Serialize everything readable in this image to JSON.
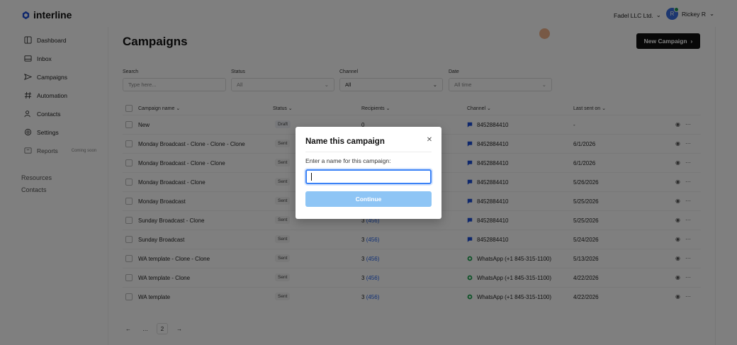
{
  "app": {
    "logo_text": "interline",
    "org_name": "Fadel LLC Ltd.",
    "user_initial": "R",
    "user_name": "Rickey R"
  },
  "sidebar": {
    "items": [
      {
        "label": "Dashboard",
        "icon": "grid-icon"
      },
      {
        "label": "Inbox",
        "icon": "inbox-icon"
      },
      {
        "label": "Campaigns",
        "icon": "send-icon"
      },
      {
        "label": "Automation",
        "icon": "hash-icon"
      },
      {
        "label": "Contacts",
        "icon": "users-icon"
      },
      {
        "label": "Settings",
        "icon": "gear-icon"
      },
      {
        "label": "Reports",
        "icon": "chart-icon",
        "tag": "Coming soon"
      }
    ],
    "resources_label": "Resources",
    "contacts_label": "Contacts"
  },
  "main": {
    "title": "Campaigns",
    "new_button_label": "New Campaign",
    "filters": {
      "search_label": "Search",
      "search_placeholder": "Type here...",
      "status_label": "Status",
      "status_value": "All",
      "channel_label": "Channel",
      "channel_value": "All",
      "date_label": "Date",
      "date_value": "All time"
    },
    "table": {
      "headers": {
        "name": "Campaign name",
        "status": "Status",
        "recipients": "Recipients",
        "channel": "Channel",
        "last_sent": "Last sent on"
      },
      "rows": [
        {
          "name": "New",
          "status": "Draft",
          "recipients": "0",
          "recipients_extra": "",
          "channel": "8452884410",
          "channel_type": "sms",
          "last_sent": "-"
        },
        {
          "name": "Monday Broadcast - Clone - Clone - Clone",
          "status": "Sent",
          "recipients": "",
          "recipients_extra": "",
          "channel": "8452884410",
          "channel_type": "sms",
          "last_sent": "6/1/2026"
        },
        {
          "name": "Monday Broadcast - Clone - Clone",
          "status": "Sent",
          "recipients": "",
          "recipients_extra": "",
          "channel": "8452884410",
          "channel_type": "sms",
          "last_sent": "6/1/2026"
        },
        {
          "name": "Monday Broadcast - Clone",
          "status": "Sent",
          "recipients": "",
          "recipients_extra": "",
          "channel": "8452884410",
          "channel_type": "sms",
          "last_sent": "5/26/2026"
        },
        {
          "name": "Monday Broadcast",
          "status": "Sent",
          "recipients": "",
          "recipients_extra": "",
          "channel": "8452884410",
          "channel_type": "sms",
          "last_sent": "5/25/2026"
        },
        {
          "name": "Sunday Broadcast - Clone",
          "status": "Sent",
          "recipients": "3",
          "recipients_extra": "(456)",
          "channel": "8452884410",
          "channel_type": "sms",
          "last_sent": "5/25/2026"
        },
        {
          "name": "Sunday Broadcast",
          "status": "Sent",
          "recipients": "3",
          "recipients_extra": "(456)",
          "channel": "8452884410",
          "channel_type": "sms",
          "last_sent": "5/24/2026"
        },
        {
          "name": "WA template - Clone - Clone",
          "status": "Sent",
          "recipients": "3",
          "recipients_extra": "(456)",
          "channel": "WhatsApp (+1 845-315-1100)",
          "channel_type": "whatsapp",
          "last_sent": "5/13/2026"
        },
        {
          "name": "WA template - Clone",
          "status": "Sent",
          "recipients": "3",
          "recipients_extra": "(456)",
          "channel": "WhatsApp (+1 845-315-1100)",
          "channel_type": "whatsapp",
          "last_sent": "4/22/2026"
        },
        {
          "name": "WA template",
          "status": "Sent",
          "recipients": "3",
          "recipients_extra": "(456)",
          "channel": "WhatsApp (+1 845-315-1100)",
          "channel_type": "whatsapp",
          "last_sent": "4/22/2026"
        }
      ]
    },
    "pagination": {
      "ellipsis": "…",
      "current_page": "2"
    }
  },
  "modal": {
    "title": "Name this campaign",
    "prompt": "Enter a name for this campaign:",
    "input_value": "",
    "continue_label": "Continue"
  },
  "colors": {
    "accent": "#3b82f6",
    "continue_disabled": "#8ec5f5",
    "sms_icon": "#1d4ed8",
    "whatsapp_icon": "#16a34a"
  }
}
